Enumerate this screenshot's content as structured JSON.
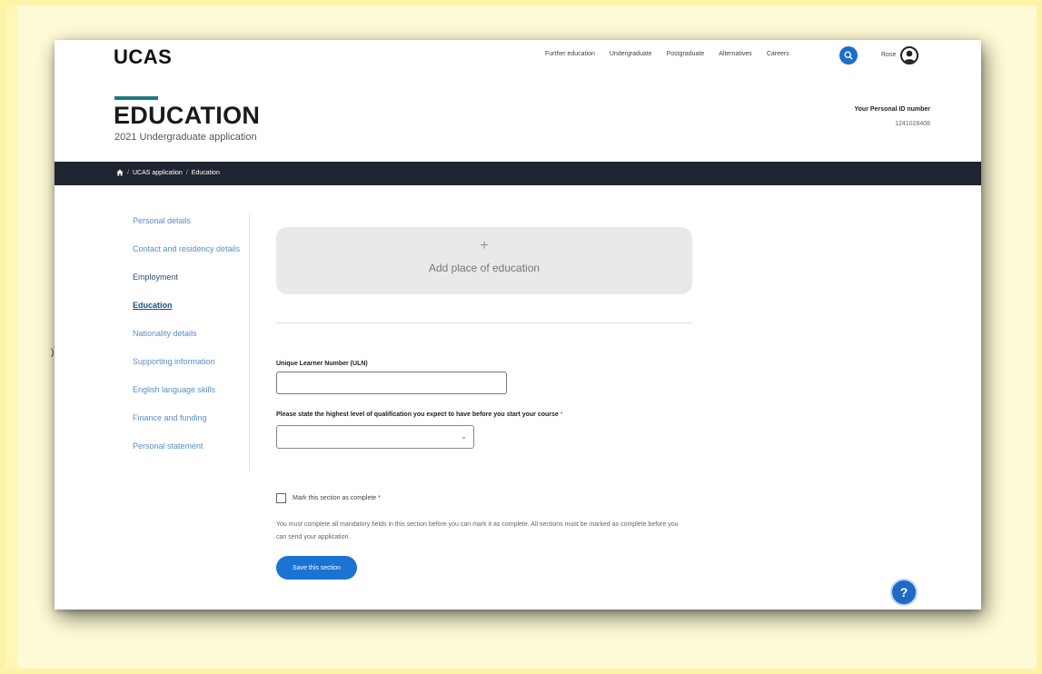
{
  "header": {
    "logo": "UCAS",
    "nav": [
      "Further education",
      "Undergraduate",
      "Postgraduate",
      "Alternatives",
      "Careers"
    ],
    "user_name": "Rose",
    "title": "EDUCATION",
    "subtitle": "2021 Undergraduate application",
    "personal_id_label": "Your Personal ID number",
    "personal_id_value": "1241028408"
  },
  "breadcrumb": {
    "home_icon": "home-icon",
    "items": [
      "UCAS application",
      "Education"
    ]
  },
  "sidebar": {
    "items": [
      "Personal details",
      "Contact and residency details",
      "Employment",
      "Education",
      "Nationality details",
      "Supporting information",
      "English language skills",
      "Finance and funding",
      "Personal statement"
    ],
    "active_index": 3
  },
  "main": {
    "add_place_symbol": "+",
    "add_place_label": "Add place of education",
    "uln_label": "Unique Learner Number (ULN)",
    "uln_value": "",
    "qualification_label": "Please state the highest level of qualification you expect to have before you start your course",
    "required_marker": "*",
    "qualification_selected": "",
    "complete_checkbox_label": "Mark this section as complete *",
    "note": "You must complete all mandatory fields in this section before you can mark it as complete. All sections must be marked as complete before you can send your application.",
    "save_button": "Save this section"
  },
  "help_button": "?",
  "colors": {
    "accent_blue": "#1b73d4",
    "nav_dark": "#1e2530",
    "title_bar_teal": "#1b7b80",
    "frame_yellow": "#fffbd6"
  }
}
